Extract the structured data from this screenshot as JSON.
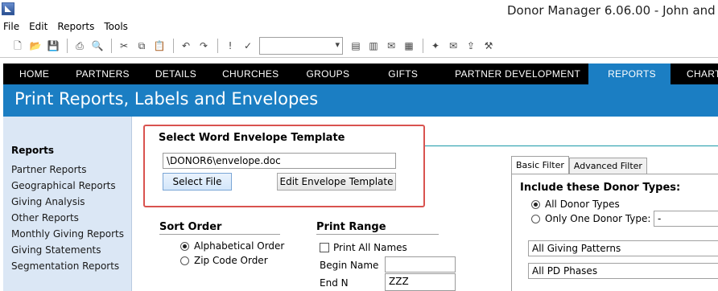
{
  "window": {
    "title": "Donor Manager 6.06.00 - John and Be"
  },
  "menu": [
    "File",
    "Edit",
    "Reports",
    "Tools"
  ],
  "toolbar": {
    "groups": [
      [
        "new-document-icon",
        "open-folder-icon",
        "save-icon"
      ],
      [
        "print-icon",
        "print-preview-icon"
      ],
      [
        "cut-icon",
        "copy-icon",
        "paste-icon"
      ],
      [
        "undo-icon",
        "redo-icon"
      ],
      [
        "alert-icon",
        "checkmark-chart-icon"
      ],
      [
        "report-icon",
        "label-icon",
        "envelope-icon",
        "spreadsheet-icon"
      ],
      [
        "sparkle-icon",
        "email-icon",
        "export-icon",
        "tools-icon"
      ]
    ]
  },
  "nav": {
    "tabs": [
      "HOME",
      "PARTNERS",
      "DETAILS",
      "CHURCHES",
      "GROUPS",
      "GIFTS",
      "PARTNER DEVELOPMENT",
      "REPORTS",
      "CHARTS"
    ],
    "active": "REPORTS",
    "active_color": "#1b7ec3"
  },
  "header": {
    "title": "Print Reports, Labels and Envelopes"
  },
  "sidebar": {
    "heading": "Reports",
    "items": [
      "Partner Reports",
      "Geographical Reports",
      "Giving Analysis",
      "Other Reports",
      "Monthly Giving Reports",
      "Giving Statements",
      "Segmentation Reports"
    ]
  },
  "envelope": {
    "title": "Select Word Envelope Template",
    "path": "\\DONOR6\\envelope.doc",
    "select_label": "Select File",
    "edit_label": "Edit Envelope Template"
  },
  "sort": {
    "title": "Sort Order",
    "options": [
      "Alphabetical Order",
      "Zip Code Order"
    ],
    "selected": "Alphabetical Order"
  },
  "range": {
    "title": "Print Range",
    "print_all": "Print All Names",
    "begin_label": "Begin Name",
    "end_label": "End N",
    "end_value": "ZZZ"
  },
  "filter": {
    "tabs": [
      "Basic Filter",
      "Advanced Filter"
    ],
    "active": "Basic Filter",
    "include_title": "Include these Donor Types:",
    "all_types": "All Donor Types",
    "one_type": "Only One Donor Type:",
    "one_type_value": "-",
    "giving_patterns": "All Giving Patterns",
    "pd_phases": "All PD Phases"
  },
  "colors": {
    "accent": "#1b7ec3",
    "highlight_border": "#d9534f"
  }
}
